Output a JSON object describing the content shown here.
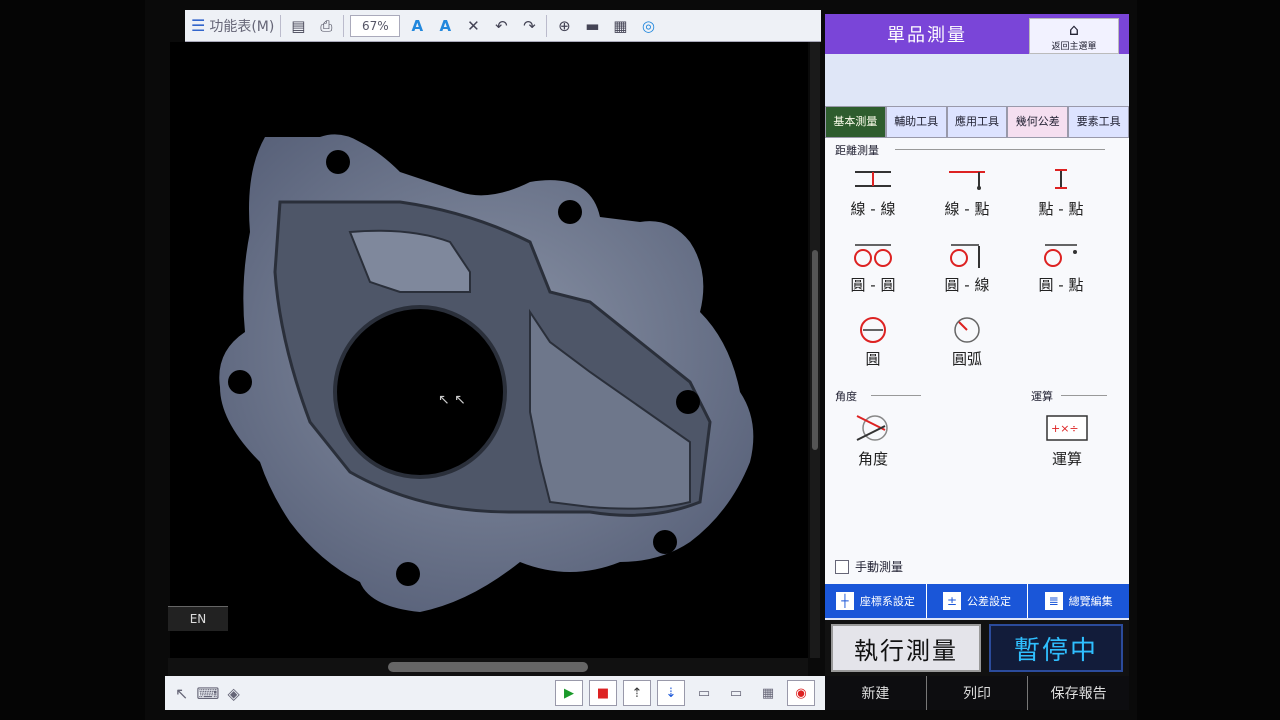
{
  "toolbar": {
    "menu_label": "功能表(M)",
    "zoom_value": "67%"
  },
  "viewport": {
    "lang_badge": "EN"
  },
  "panel": {
    "title": "單品測量",
    "home_label": "返回主選單",
    "tabs": [
      {
        "label": "基本測量",
        "active": true
      },
      {
        "label": "輔助工具",
        "active": false
      },
      {
        "label": "應用工具",
        "active": false
      },
      {
        "label": "幾何公差",
        "active": false
      },
      {
        "label": "要素工具",
        "active": false
      }
    ],
    "distance_section": "距離測量",
    "tools": [
      {
        "label": "線 - 線",
        "icon": "line-line-icon"
      },
      {
        "label": "線 - 點",
        "icon": "line-point-icon"
      },
      {
        "label": "點 - 點",
        "icon": "point-point-icon"
      },
      {
        "label": "圓 - 圓",
        "icon": "circle-circle-icon"
      },
      {
        "label": "圓 - 線",
        "icon": "circle-line-icon"
      },
      {
        "label": "圓 - 點",
        "icon": "circle-point-icon"
      },
      {
        "label": "圓",
        "icon": "circle-icon"
      },
      {
        "label": "圓弧",
        "icon": "arc-icon"
      }
    ],
    "angle_section": "角度",
    "angle_tool": "角度",
    "calc_section": "運算",
    "calc_tool": "運算",
    "manual_label": "手動測量",
    "blue_bar": [
      {
        "label": "座標系設定"
      },
      {
        "label": "公差設定"
      },
      {
        "label": "總覽編集"
      }
    ],
    "exec_label": "執行測量",
    "pause_label": "暫停中",
    "footer": [
      {
        "label": "新建"
      },
      {
        "label": "列印"
      },
      {
        "label": "保存報告"
      }
    ]
  },
  "colors": {
    "header_purple": "#7a45d8",
    "active_tab_green": "#2e5d2e",
    "blue_bar": "#1a56d8",
    "pause_text": "#2fbfff"
  }
}
